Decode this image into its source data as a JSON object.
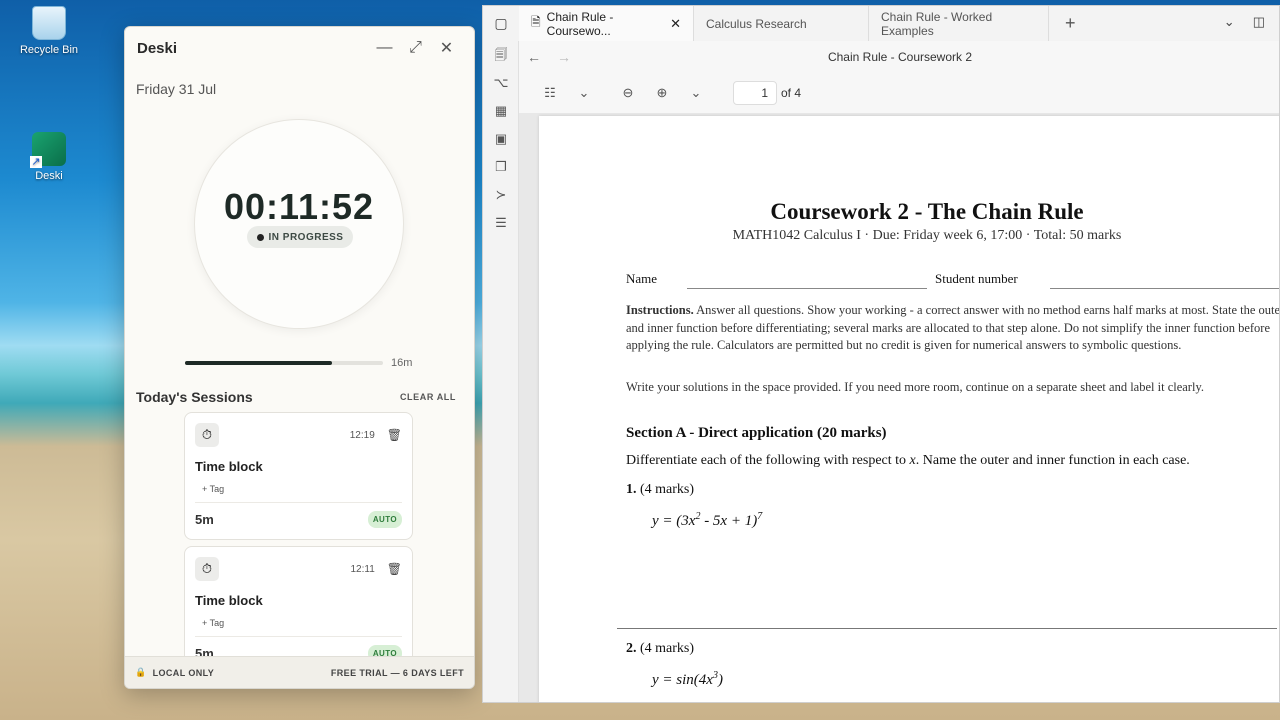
{
  "desktop": {
    "icons": [
      {
        "label": "Recycle Bin"
      },
      {
        "label": "Deski"
      }
    ]
  },
  "deski": {
    "title": "Deski",
    "date": "Friday 31 Jul",
    "timer": "00:11:52",
    "status": "IN PROGRESS",
    "progress_fraction": 0.74,
    "progress_label": "16m",
    "sessions_title": "Today's Sessions",
    "clear_all": "CLEAR ALL",
    "sessions": [
      {
        "time": "12:19",
        "title": "Time block",
        "tag": "+ Tag",
        "duration": "5m",
        "badge": "AUTO"
      },
      {
        "time": "12:11",
        "title": "Time block",
        "tag": "+ Tag",
        "duration": "5m",
        "badge": "AUTO"
      }
    ],
    "footer_left": "LOCAL ONLY",
    "footer_right": "FREE TRIAL — 6 DAYS LEFT"
  },
  "browser": {
    "tabs": [
      {
        "label": "Chain Rule - Coursewo...",
        "active": true
      },
      {
        "label": "Calculus Research",
        "active": false
      },
      {
        "label": "Chain Rule - Worked Examples",
        "active": false
      }
    ],
    "doc_title": "Chain Rule - Coursework 2",
    "page_current": "1",
    "page_total": "of 4"
  },
  "document": {
    "heading": "Coursework 2 - The Chain Rule",
    "subheading": "MATH1042 Calculus I  ·  Due: Friday week 6, 17:00  ·  Total: 50 marks",
    "name_label": "Name",
    "student_label": "Student number",
    "instructions_bold": "Instructions.",
    "instructions": " Answer all questions. Show your working - a correct answer with no method earns half marks at most. State the outer and inner function before differentiating; several marks are allocated to that step alone. Do not simplify the inner function before applying the rule. Calculators are permitted but no credit is given for numerical answers to symbolic questions.",
    "instructions2": "Write your solutions in the space provided. If you need more room, continue on a separate sheet and label it clearly.",
    "sectionA": "Section A - Direct application (20 marks)",
    "sectionA_desc_pre": "Differentiate each of the following with respect to ",
    "sectionA_var": "x",
    "sectionA_desc_post": ". Name the outer and inner function in each case.",
    "q1_num": "1.",
    "q1_marks": " (4 marks)",
    "q1_eq_a": "y = (3x",
    "q1_eq_exp1": "2",
    "q1_eq_b": " - 5x + 1)",
    "q1_eq_exp2": "7",
    "q2_num": "2.",
    "q2_marks": " (4 marks)",
    "q2_eq_a": "y = sin(4x",
    "q2_eq_exp": "3",
    "q2_eq_b": ")"
  }
}
